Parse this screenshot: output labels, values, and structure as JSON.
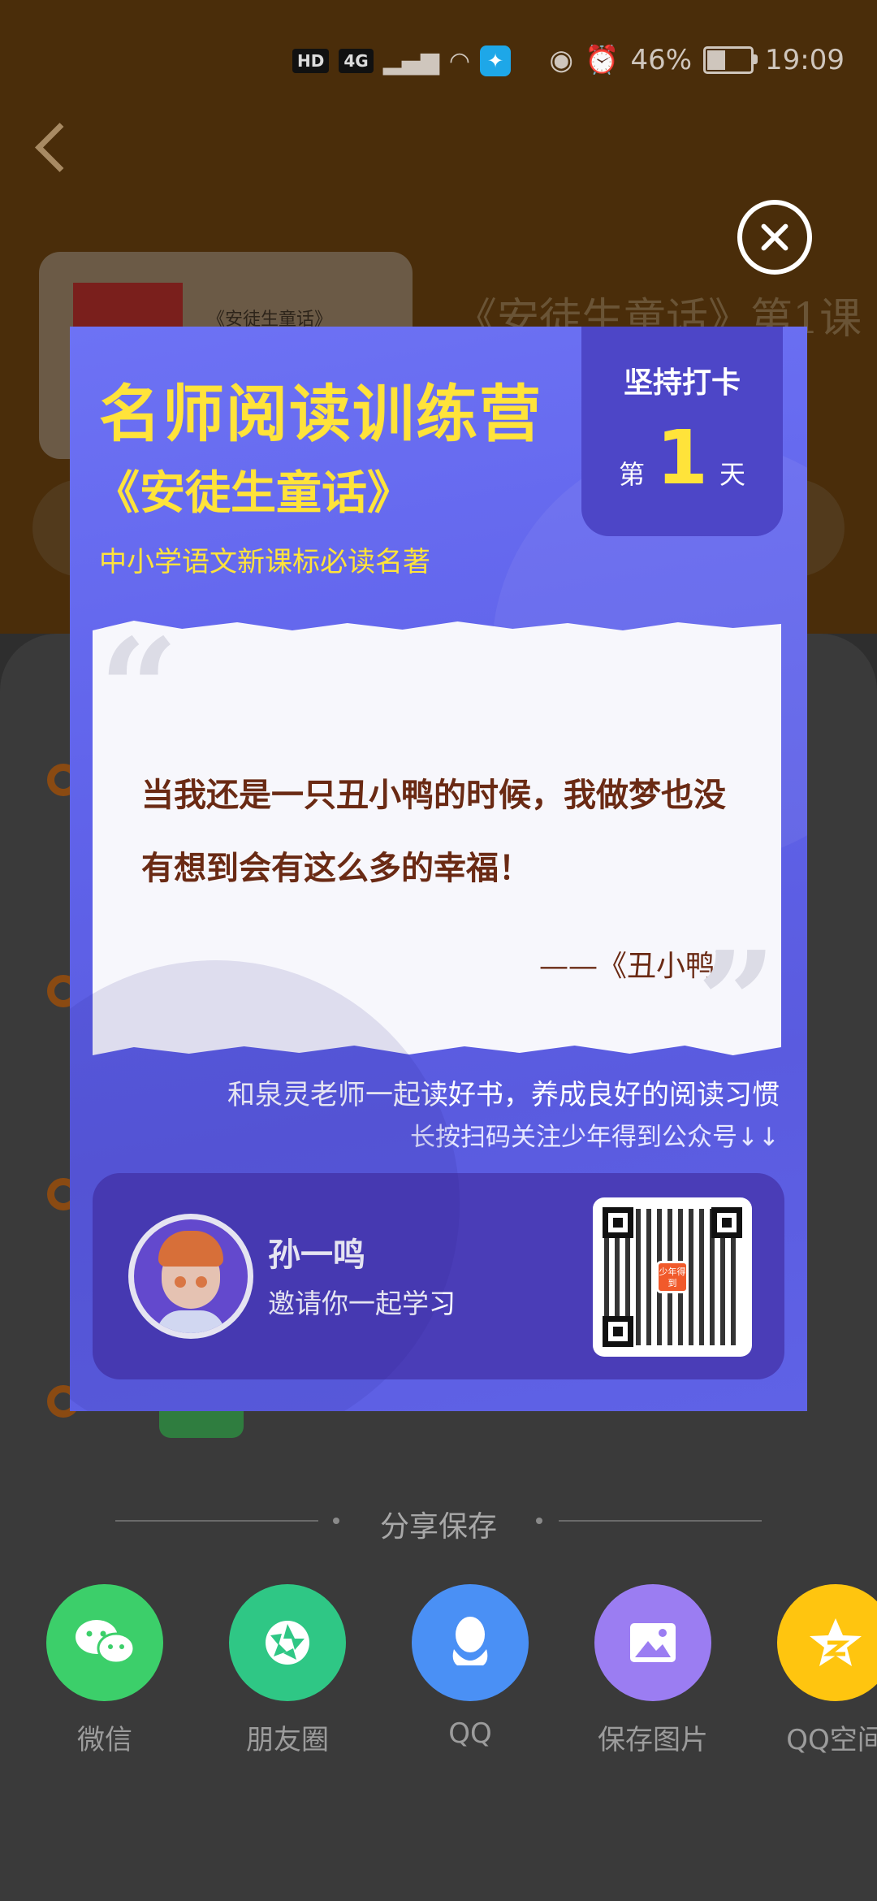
{
  "status_bar": {
    "left_chips": [
      "HD",
      "4G"
    ],
    "battery": "46%",
    "time": "19:09"
  },
  "background": {
    "book_cover_title": "《安徒生童话》",
    "lesson_title": "《安徒生童话》第1课"
  },
  "poster": {
    "title": "名师阅读训练营",
    "book": "《安徒生童话》",
    "subtitle": "中小学语文新课标必读名著",
    "checkin": {
      "label": "坚持打卡",
      "day_prefix": "第",
      "day_number": "1",
      "day_suffix": "天"
    },
    "quote": {
      "open_mark": "“",
      "close_mark": "”",
      "text": "当我还是一只丑小鸭的时候，我做梦也没有想到会有这么多的幸福！",
      "source": "——《丑小鸭》"
    },
    "line1": "和泉灵老师一起读好书，养成良好的阅读习惯",
    "line2": "长按扫码关注少年得到公众号↓↓",
    "inviter": {
      "name": "孙一鸣",
      "message": "邀请你一起学习"
    },
    "qr_logo_text": "少年得到"
  },
  "share": {
    "title": "分享保存",
    "items": [
      {
        "label": "微信",
        "color": "#3ccf6a",
        "icon": "wechat-icon"
      },
      {
        "label": "朋友圈",
        "color": "#2fc785",
        "icon": "moments-icon"
      },
      {
        "label": "QQ",
        "color": "#4a90f5",
        "icon": "qq-icon"
      },
      {
        "label": "保存图片",
        "color": "#9b7df2",
        "icon": "image-icon"
      },
      {
        "label": "QQ空间",
        "color": "#ffc50f",
        "icon": "qzone-icon"
      }
    ]
  }
}
